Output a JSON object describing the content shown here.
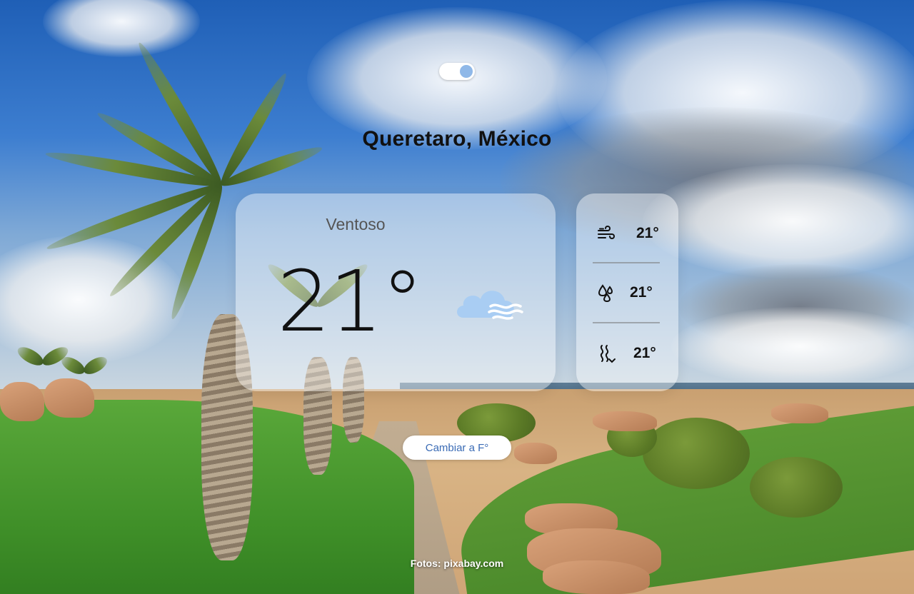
{
  "app": {
    "location": "Queretaro, México",
    "unit_toggle_state": "on"
  },
  "current": {
    "condition": "Ventoso",
    "temperature": "21°",
    "condition_icon": "cloud-wind-icon"
  },
  "details": [
    {
      "icon": "wind-icon",
      "value": "21°"
    },
    {
      "icon": "humidity-drops-icon",
      "value": "21°"
    },
    {
      "icon": "heat-waves-icon",
      "value": "21°"
    }
  ],
  "actions": {
    "change_units_label": "Cambiar a F°"
  },
  "footer": {
    "credits": "Fotos: pixabay.com"
  },
  "colors": {
    "toggle_knob": "#8fb8e8",
    "button_text": "#3a6bb5",
    "icon_cloud": "#a9cdf3"
  }
}
